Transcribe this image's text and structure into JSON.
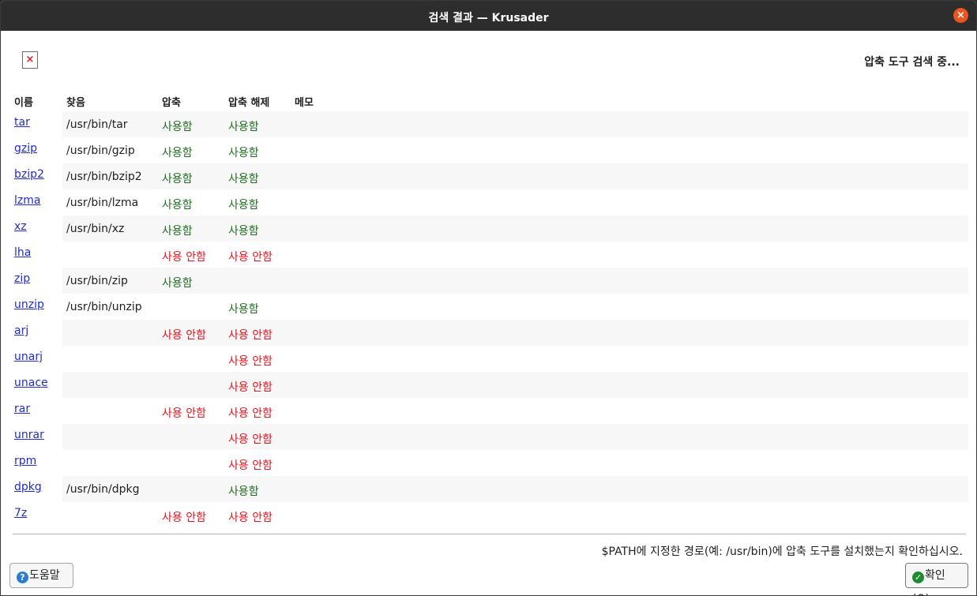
{
  "window": {
    "title": "검색 결과 — Krusader",
    "close_glyph": "×"
  },
  "header": {
    "broken_image_glyph": "×",
    "status_text": "압축 도구 검색 중..."
  },
  "columns": [
    "이름",
    "찾음",
    "압축",
    "압축 해제",
    "메모"
  ],
  "rows": [
    {
      "name": "tar",
      "found": "/usr/bin/tar",
      "pack": "사용함",
      "unpack": "사용함",
      "memo": ""
    },
    {
      "name": "gzip",
      "found": "/usr/bin/gzip",
      "pack": "사용함",
      "unpack": "사용함",
      "memo": ""
    },
    {
      "name": "bzip2",
      "found": "/usr/bin/bzip2",
      "pack": "사용함",
      "unpack": "사용함",
      "memo": ""
    },
    {
      "name": "lzma",
      "found": "/usr/bin/lzma",
      "pack": "사용함",
      "unpack": "사용함",
      "memo": ""
    },
    {
      "name": "xz",
      "found": "/usr/bin/xz",
      "pack": "사용함",
      "unpack": "사용함",
      "memo": ""
    },
    {
      "name": "lha",
      "found": "",
      "pack": "사용 안함",
      "unpack": "사용 안함",
      "memo": ""
    },
    {
      "name": "zip",
      "found": "/usr/bin/zip",
      "pack": "사용함",
      "unpack": "",
      "memo": ""
    },
    {
      "name": "unzip",
      "found": "/usr/bin/unzip",
      "pack": "",
      "unpack": "사용함",
      "memo": ""
    },
    {
      "name": "arj",
      "found": "",
      "pack": "사용 안함",
      "unpack": "사용 안함",
      "memo": ""
    },
    {
      "name": "unarj",
      "found": "",
      "pack": "",
      "unpack": "사용 안함",
      "memo": ""
    },
    {
      "name": "unace",
      "found": "",
      "pack": "",
      "unpack": "사용 안함",
      "memo": ""
    },
    {
      "name": "rar",
      "found": "",
      "pack": "사용 안함",
      "unpack": "사용 안함",
      "memo": ""
    },
    {
      "name": "unrar",
      "found": "",
      "pack": "",
      "unpack": "사용 안함",
      "memo": ""
    },
    {
      "name": "rpm",
      "found": "",
      "pack": "",
      "unpack": "사용 안함",
      "memo": ""
    },
    {
      "name": "dpkg",
      "found": "/usr/bin/dpkg",
      "pack": "",
      "unpack": "사용함",
      "memo": ""
    },
    {
      "name": "7z",
      "found": "",
      "pack": "사용 안함",
      "unpack": "사용 안함",
      "memo": ""
    }
  ],
  "status_values": {
    "enabled": "사용함",
    "disabled": "사용 안함"
  },
  "colors": {
    "enabled": "#1f6e1f",
    "disabled": "#e8121b",
    "link": "#1e2bd4",
    "close_button": "#e95420"
  },
  "footer": {
    "note": "$PATH에 지정한 경로(예: /usr/bin)에 압축 도구를 설치했는지 확인하십시오.",
    "help_label": "도움말",
    "help_icon_glyph": "?",
    "ok_label": "확인(O)",
    "ok_icon_glyph": "✓"
  },
  "icons": {
    "help": "help-icon",
    "ok": "check-icon",
    "close": "close-icon",
    "broken_image": "broken-image-icon"
  }
}
